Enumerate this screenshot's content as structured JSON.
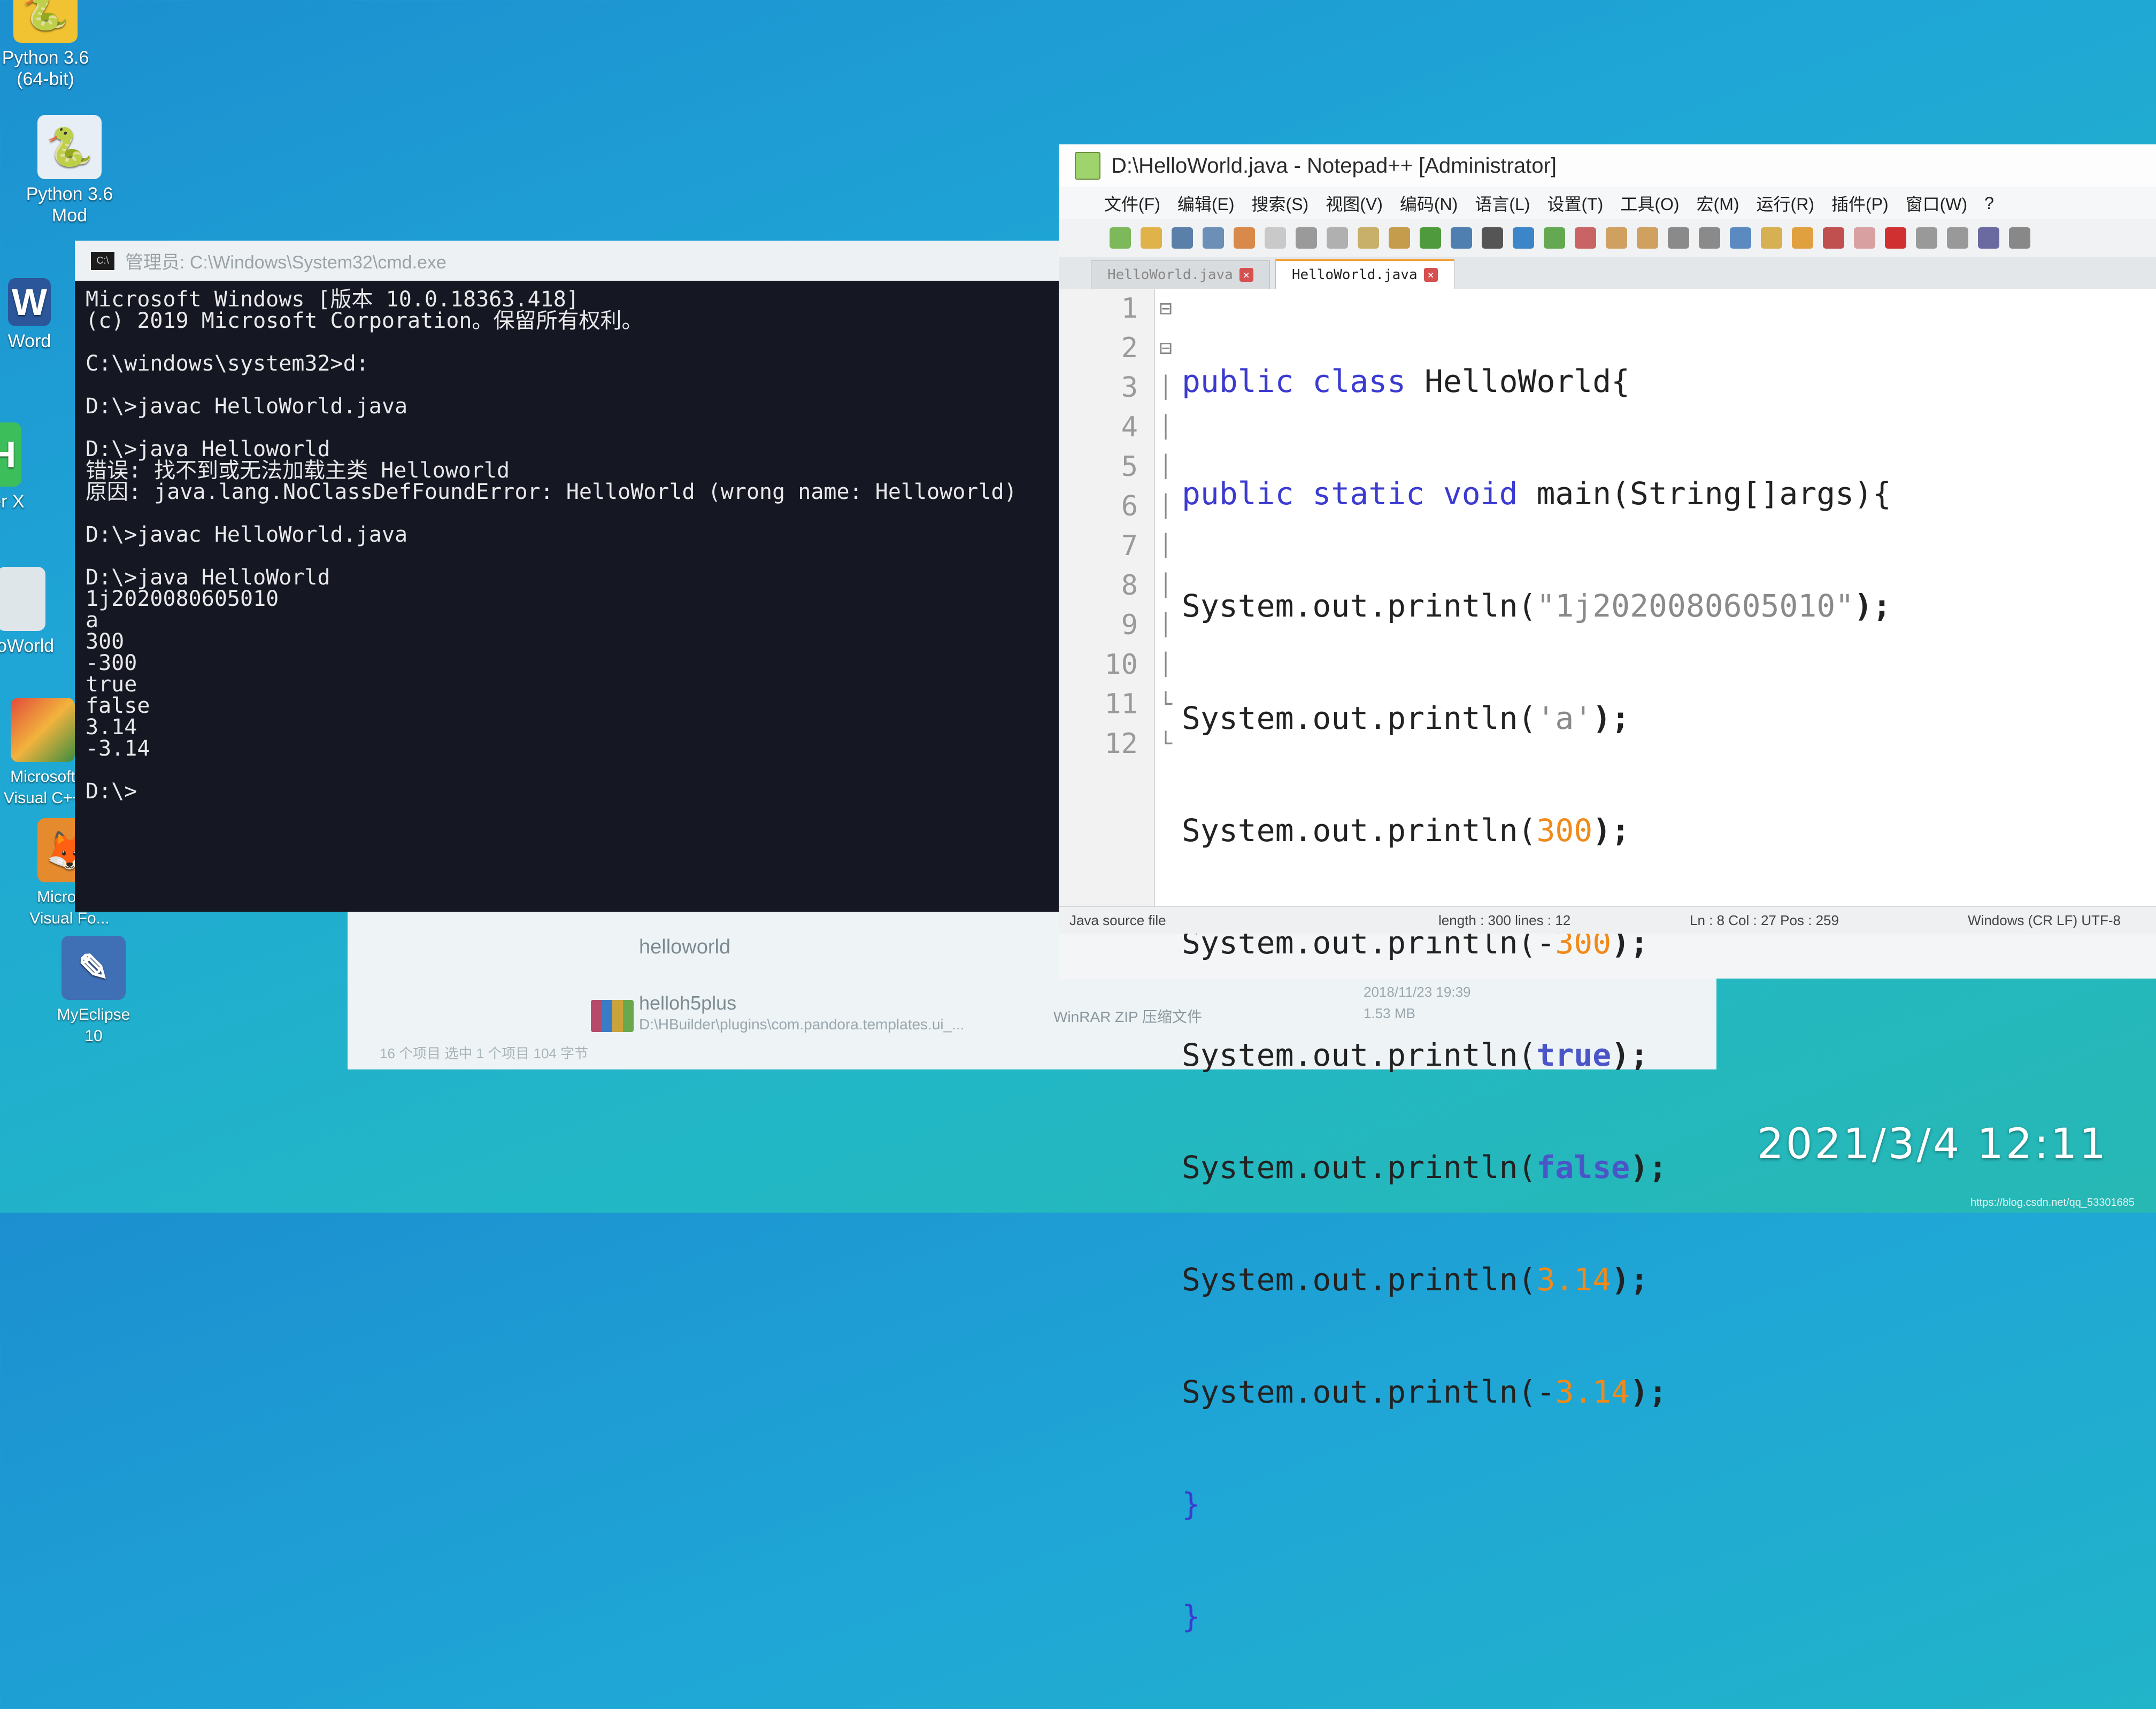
{
  "desktop": {
    "icons": [
      {
        "label": "Python 3.6\n(64-bit)",
        "icon": "python-icon"
      },
      {
        "label": "Python 3.6\nMod",
        "icon": "python-module-icon"
      },
      {
        "label": "Word",
        "icon": "word-icon"
      },
      {
        "label": "der X",
        "icon": "app-icon"
      },
      {
        "label": "lloWorld",
        "icon": "folder-icon"
      },
      {
        "label": "Microsoft\nVisual C++",
        "icon": "visual-cpp-icon"
      },
      {
        "label": "Microsoft\nVisual Fo...",
        "icon": "visual-foxpro-icon"
      },
      {
        "label": "MyEclipse\n10",
        "icon": "myeclipse-icon"
      }
    ]
  },
  "explorer": {
    "item1_name": "helloworld",
    "item2_name": "helloh5plus",
    "item2_path": "D:\\HBuilder\\plugins\\com.pandora.templates.ui_...",
    "item2_type": "WinRAR ZIP 压缩文件",
    "item2_date": "2018/11/23 19:39",
    "item2_size": "1.53 MB",
    "status": "16 个项目    选中 1 个项目  104 字节"
  },
  "cmd": {
    "title": "管理员: C:\\Windows\\System32\\cmd.exe",
    "lines": [
      "Microsoft Windows [版本 10.0.18363.418]",
      "(c) 2019 Microsoft Corporation。保留所有权利。",
      "",
      "C:\\windows\\system32>d:",
      "",
      "D:\\>javac HelloWorld.java",
      "",
      "D:\\>java Helloworld",
      "错误: 找不到或无法加载主类 Helloworld",
      "原因: java.lang.NoClassDefFoundError: HelloWorld (wrong name: Helloworld)",
      "",
      "D:\\>javac HelloWorld.java",
      "",
      "D:\\>java HelloWorld",
      "1j2020080605010",
      "a",
      "300",
      "-300",
      "true",
      "false",
      "3.14",
      "-3.14",
      "",
      "D:\\>"
    ]
  },
  "notepad": {
    "title": "D:\\HelloWorld.java - Notepad++ [Administrator]",
    "menu": [
      "文件(F)",
      "编辑(E)",
      "搜索(S)",
      "视图(V)",
      "编码(N)",
      "语言(L)",
      "设置(T)",
      "工具(O)",
      "宏(M)",
      "运行(R)",
      "插件(P)",
      "窗口(W)",
      "?"
    ],
    "tabs": [
      "HelloWorld.java",
      "HelloWorld.java"
    ],
    "line_numbers": [
      "1",
      "2",
      "3",
      "4",
      "5",
      "6",
      "7",
      "8",
      "9",
      "10",
      "11",
      "12"
    ],
    "code": {
      "l1": {
        "kw": "public class",
        "rest": " HelloWorld{"
      },
      "l2": {
        "kw": "public static void",
        "rest": " main(String[]args){"
      },
      "l3": {
        "pre": "System.out.println(",
        "arg": "\"1j2020080605010\"",
        "post": ");"
      },
      "l4": {
        "pre": "System.out.println(",
        "arg": "'a'",
        "post": ");"
      },
      "l5": {
        "pre": "System.out.println(",
        "arg": "300",
        "post": ");"
      },
      "l6": {
        "pre": "System.out.println(-",
        "arg": "300",
        "post": ");"
      },
      "l7": {
        "pre": "System.out.println(",
        "arg": "true",
        "post": ");"
      },
      "l8": {
        "pre": "System.out.println(",
        "arg": "false",
        "post": ");"
      },
      "l9": {
        "pre": "System.out.println(",
        "arg": "3.14",
        "post": ");"
      },
      "l10": {
        "pre": "System.out.println(-",
        "arg": "3.14",
        "post": ");"
      },
      "l11": "}",
      "l12": "}"
    },
    "status": {
      "filetype": "Java source file",
      "length": "length : 300    lines : 12",
      "pos": "Ln : 8    Col : 27    Pos : 259",
      "eol": "Windows (CR LF)    UTF-8"
    }
  },
  "timestamp": "2021/3/4  12:11",
  "watermark": "https://blog.csdn.net/qq_53301685",
  "colors": {
    "keyword": "#3b3bd0",
    "number": "#f08a1a",
    "string": "#8a8a8a",
    "console_bg": "#151822"
  }
}
